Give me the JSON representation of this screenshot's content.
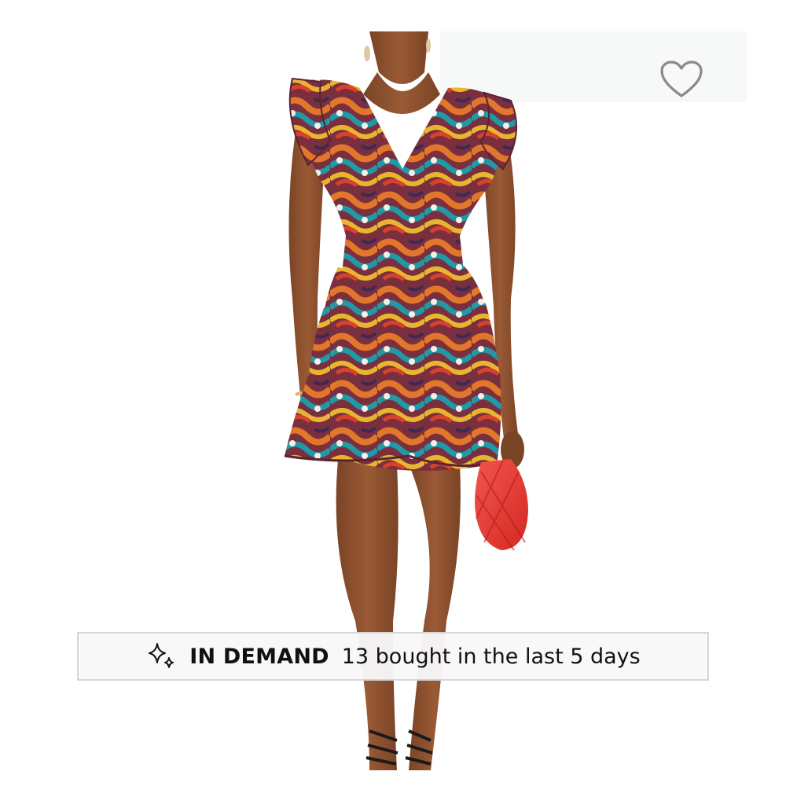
{
  "product_card": {
    "image_alt": "Model wearing multicolor swirl print tiered ruffle mini dress holding a red knit bag",
    "wishlist_icon": "heart-outline-icon",
    "badge": {
      "icon": "sparkle-icon",
      "label": "IN DEMAND",
      "text": "13 bought in the last 5 days"
    },
    "colors": {
      "banner_border": "#d6d6d6",
      "banner_bg": "#f8f8f8",
      "text": "#111111",
      "bag": "#e8342f"
    }
  }
}
